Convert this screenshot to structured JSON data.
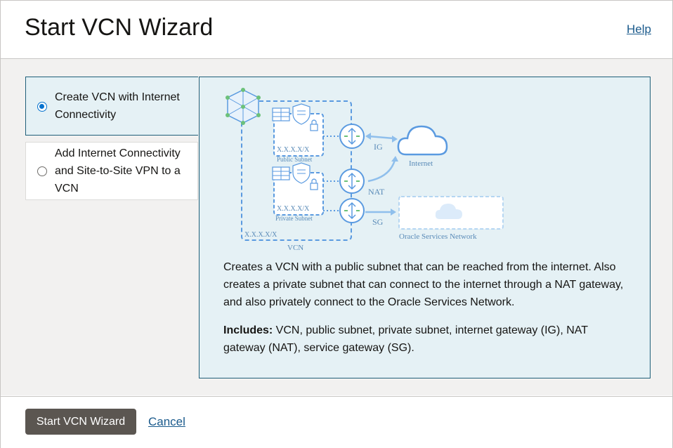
{
  "header": {
    "title": "Start VCN Wizard",
    "help_label": "Help"
  },
  "options": [
    {
      "label": "Create VCN with Internet Connectivity",
      "selected": true
    },
    {
      "label": "Add Internet Connectivity and Site-to-Site VPN to a VCN",
      "selected": false
    }
  ],
  "diagram": {
    "public_subnet_label": "Public Subnet",
    "private_subnet_label": "Private Subnet",
    "public_cidr": "X.X.X.X/X",
    "private_cidr": "X.X.X.X/X",
    "vcn_cidr": "X.X.X.X/X",
    "vcn_label": "VCN",
    "ig_label": "IG",
    "nat_label": "NAT",
    "sg_label": "SG",
    "internet_label": "Internet",
    "osn_label": "Oracle Services Network"
  },
  "detail": {
    "description": "Creates a VCN with a public subnet that can be reached from the internet. Also creates a private subnet that can connect to the internet through a NAT gateway, and also privately connect to the Oracle Services Network.",
    "includes_label": "Includes:",
    "includes_text": " VCN, public subnet, private subnet, internet gateway (IG), NAT gateway (NAT), service gateway (SG)."
  },
  "footer": {
    "primary_label": "Start VCN Wizard",
    "cancel_label": "Cancel"
  },
  "colors": {
    "accent": "#0572ce",
    "selected_bg": "#e5f1f5",
    "selected_border": "#1f5f79",
    "primary_button": "#5b5651",
    "link": "#1a5a8c",
    "diagram_blue": "#5a9ae0"
  }
}
